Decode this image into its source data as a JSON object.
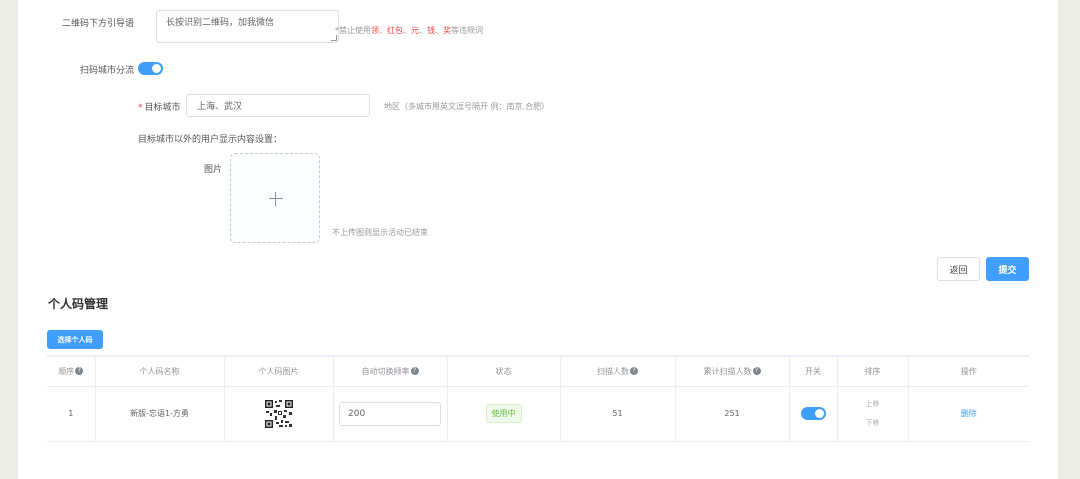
{
  "form": {
    "guide_label": "二维码下方引导语",
    "guide_value": "长按识别二维码，加我微信",
    "guide_hint_prefix": "*禁止使用",
    "guide_hint_banned": [
      "领",
      "红包",
      "元",
      "钱",
      "奖"
    ],
    "guide_hint_sep": "、",
    "guide_hint_suffix": "等违规词",
    "city_split_label": "扫码城市分流",
    "target_city_label": "目标城市",
    "target_city_value": "上海、武汉",
    "target_city_hint": "地区（多城市用英文逗号隔开 例：南京,合肥）",
    "others_setting_label": "目标城市以外的用户显示内容设置：",
    "image_label": "图片",
    "image_hint": "不上传图则显示活动已结束",
    "back_button": "返回",
    "submit_button": "提交"
  },
  "personal_codes": {
    "title": "个人码管理",
    "select_button": "选择个人码",
    "columns": [
      "顺序",
      "个人码名称",
      "个人码图片",
      "自动切换频率",
      "状态",
      "扫描人数",
      "累计扫描人数",
      "开关",
      "排序",
      "操作"
    ],
    "help_mark": "?",
    "rows": [
      {
        "order": "1",
        "name": "新版-忘语1-方勇",
        "frequency": "200",
        "status": "使用中",
        "scans": "51",
        "total_scans": "251",
        "switch_on": true,
        "sort_up": "上移",
        "sort_down": "下移",
        "action": "删除"
      }
    ]
  },
  "colors": {
    "accent": "#409eff",
    "danger": "#f04141",
    "success": "#67c23a",
    "background": "#eeeee9"
  }
}
